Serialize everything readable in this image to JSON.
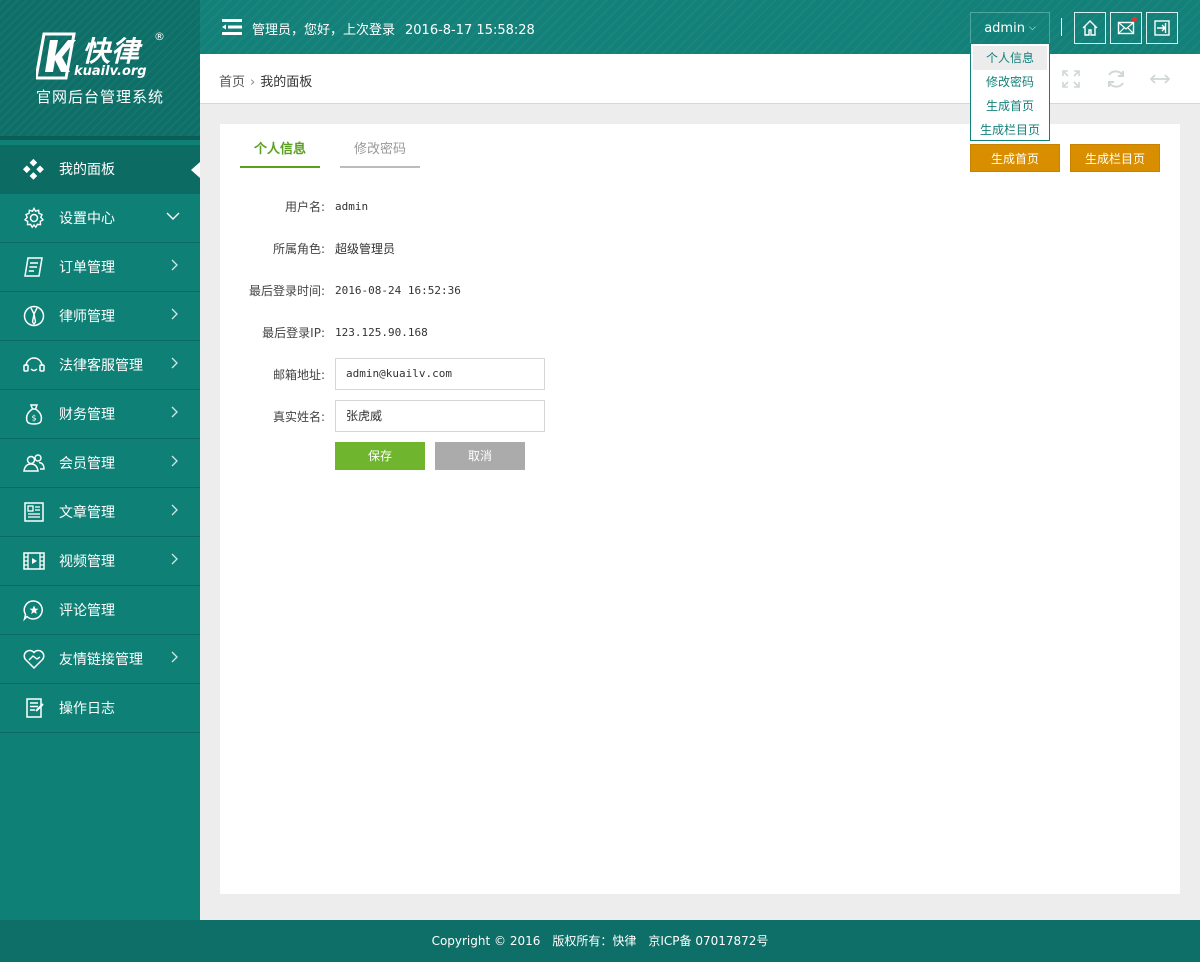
{
  "brand": {
    "logo_cn": "快律",
    "logo_en": "kuailv.org",
    "registered": "®",
    "subtitle": "官网后台管理系统"
  },
  "header": {
    "welcome": "管理员，您好，上次登录",
    "last_login": "2016-8-17 15:58:28",
    "user": "admin",
    "chevron": "⌵"
  },
  "user_dropdown": {
    "items": [
      "个人信息",
      "修改密码",
      "生成首页",
      "生成栏目页"
    ]
  },
  "sidebar": {
    "items": [
      {
        "label": "我的面板",
        "icon": "dashboard-icon",
        "active": true,
        "arrow": "none"
      },
      {
        "label": "设置中心",
        "icon": "gear-icon",
        "arrow": "down"
      },
      {
        "label": "订单管理",
        "icon": "order-icon",
        "arrow": "right"
      },
      {
        "label": "律师管理",
        "icon": "lawyer-icon",
        "arrow": "right"
      },
      {
        "label": "法律客服管理",
        "icon": "headset-icon",
        "arrow": "right"
      },
      {
        "label": "财务管理",
        "icon": "money-bag-icon",
        "arrow": "right"
      },
      {
        "label": "会员管理",
        "icon": "members-icon",
        "arrow": "right"
      },
      {
        "label": "文章管理",
        "icon": "newspaper-icon",
        "arrow": "right"
      },
      {
        "label": "视频管理",
        "icon": "film-icon",
        "arrow": "right"
      },
      {
        "label": "评论管理",
        "icon": "comment-star-icon",
        "arrow": "none"
      },
      {
        "label": "友情链接管理",
        "icon": "heart-handshake-icon",
        "arrow": "right"
      },
      {
        "label": "操作日志",
        "icon": "log-icon",
        "arrow": "none"
      }
    ]
  },
  "breadcrumb": {
    "home": "首页",
    "separator": "›",
    "current": "我的面板"
  },
  "tabs": [
    "个人信息",
    "修改密码"
  ],
  "actions": {
    "gen_home": "生成首页",
    "gen_column": "生成栏目页"
  },
  "profile": {
    "username_label": "用户名:",
    "username": "admin",
    "role_label": "所属角色:",
    "role": "超级管理员",
    "last_login_label": "最后登录时间:",
    "last_login_time": "2016-08-24 16:52:36",
    "last_ip_label": "最后登录IP:",
    "last_ip": "123.125.90.168",
    "email_label": "邮箱地址:",
    "email": "admin@kuailv.com",
    "realname_label": "真实姓名:",
    "realname": "张虎威",
    "save": "保存",
    "cancel": "取消"
  },
  "footer": {
    "text": "Copyright © 2016　版权所有：快律　京ICP备 07017872号"
  },
  "colors": {
    "sidebar": "#0f8076",
    "accent_green": "#6fb52d",
    "gen_button": "#d98e00"
  }
}
